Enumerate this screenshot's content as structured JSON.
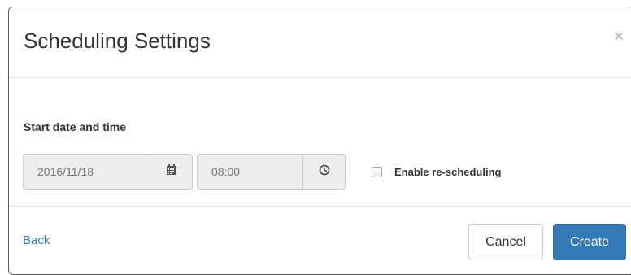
{
  "dialog": {
    "title": "Scheduling Settings",
    "close_glyph": "×"
  },
  "form": {
    "section_label": "Start date and time",
    "date_value": "2016/11/18",
    "date_icon": "calendar-icon",
    "time_value": "08:00",
    "time_icon": "clock-icon",
    "reschedule_label": "Enable re-scheduling",
    "reschedule_checked": false
  },
  "footer": {
    "back_label": "Back",
    "cancel_label": "Cancel",
    "create_label": "Create"
  },
  "colors": {
    "primary": "#337ab7",
    "link": "#337ab7",
    "disabled_input_bg": "#eeeeee"
  }
}
